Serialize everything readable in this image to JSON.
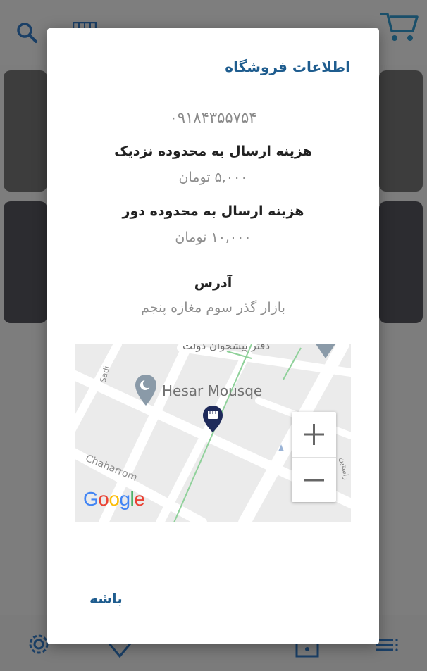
{
  "dialog": {
    "title": "اطلاعات فروشگاه",
    "phone": "۰۹۱۸۴۳۵۵۷۵۴",
    "near_label": "هزینه ارسال به محدوده نزدیک",
    "near_value": "۵,۰۰۰ تومان",
    "far_label": "هزینه ارسال به محدوده دور",
    "far_value": "۱۰,۰۰۰ تومان",
    "address_label": "آدرس",
    "address_value": "بازار گذر سوم مغازه پنجم",
    "ok_button": "باشه"
  },
  "map": {
    "place_label": "Hesar Mousqe",
    "street_sadi": "Sadi",
    "street_chaharrom": "Chaharrom",
    "street_top": "دفتر پیشخوان دولت",
    "street_right": "راستین",
    "google_logo": "Google",
    "zoom_in": "+",
    "zoom_out": "−"
  },
  "colors": {
    "accent": "#1f5d8f",
    "marker": "#1e2a5a"
  },
  "icons": [
    "search-icon",
    "cart-icon",
    "grid-icon",
    "settings-icon",
    "heart-icon",
    "shop-icon",
    "menu-icon",
    "store-marker-icon",
    "mosque-pin-icon"
  ]
}
